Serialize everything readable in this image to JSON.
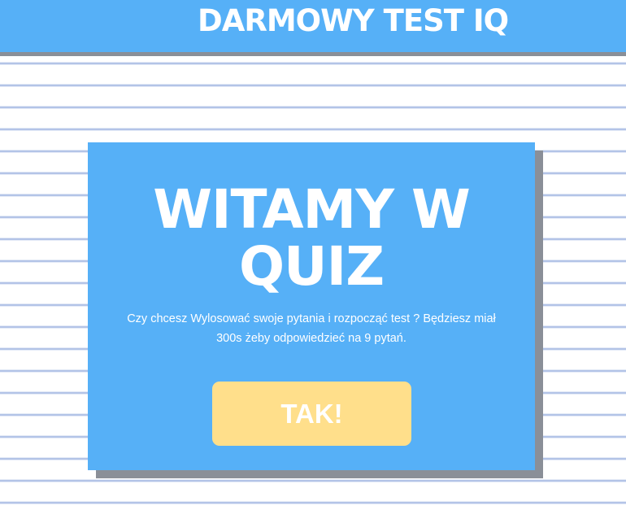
{
  "header": {
    "title": "DARMOWY TEST IQ"
  },
  "welcome": {
    "title": "WITAMY W QUIZ",
    "description": "Czy chcesz Wylosować swoje pytania i rozpocząć test ? Będziesz miał 300s żeby odpowiedzieć na 9 pytań.",
    "start_label": "TAK!"
  },
  "colors": {
    "primary": "#56b0f7",
    "button": "#ffdf8b",
    "shadow": "#8a8f98",
    "stripe": "#9fb3e0"
  }
}
